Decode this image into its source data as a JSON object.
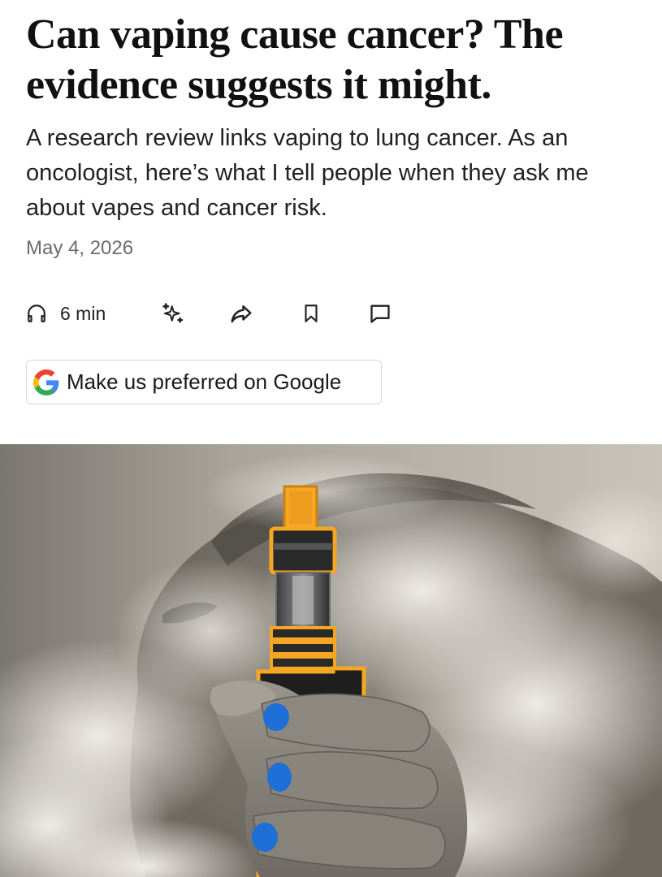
{
  "article": {
    "headline": "Can vaping cause cancer? The evidence suggests it might.",
    "dek": "A research review links vaping to lung cancer. As an oncologist, here’s what I tell people when they ask me about vapes and cancer risk.",
    "date": "May 4, 2026"
  },
  "actions": {
    "listen_label": "6 min",
    "items": [
      {
        "name": "listen",
        "icon": "headphones-icon"
      },
      {
        "name": "ai-summary",
        "icon": "sparkles-icon"
      },
      {
        "name": "share",
        "icon": "share-arrow-icon"
      },
      {
        "name": "save",
        "icon": "bookmark-icon"
      },
      {
        "name": "comments",
        "icon": "comment-icon"
      }
    ]
  },
  "google_prompt": {
    "label": "Make us preferred on Google",
    "icon": "google-g-logo-icon"
  },
  "hero_image": {
    "subject": "person exhaling vapor while holding a vape pen",
    "accent_colors": {
      "outline": "#f5a623",
      "nails": "#1e6fd6"
    }
  }
}
